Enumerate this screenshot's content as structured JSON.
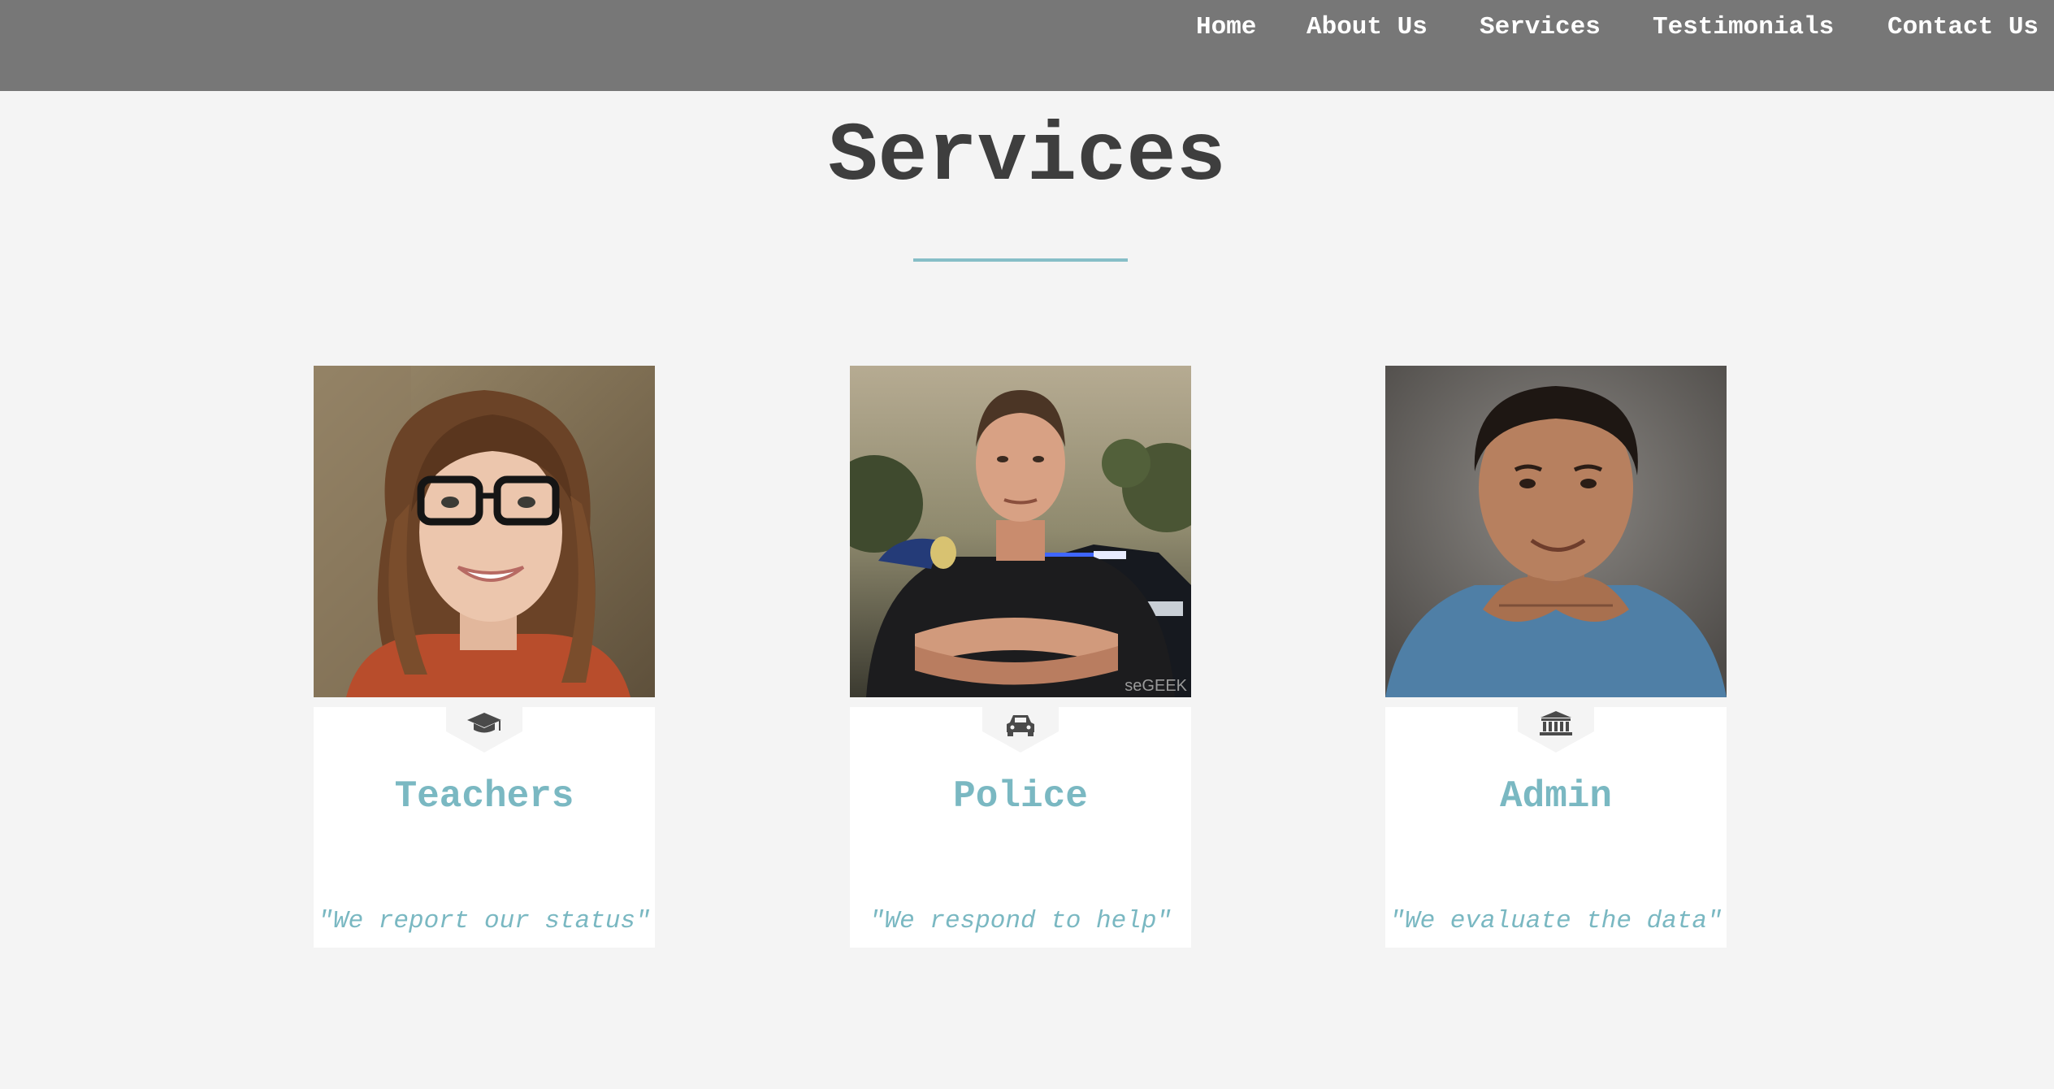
{
  "nav": {
    "items": [
      {
        "label": "Home"
      },
      {
        "label": "About Us"
      },
      {
        "label": "Services"
      },
      {
        "label": "Testimonials"
      },
      {
        "label": "Contact Us"
      }
    ]
  },
  "section": {
    "title": "Services"
  },
  "cards": [
    {
      "title": "Teachers",
      "quote": "\"We report our status\"",
      "icon": "graduation-cap-icon"
    },
    {
      "title": "Police",
      "quote": "\"We respond to help\"",
      "icon": "car-icon"
    },
    {
      "title": "Admin",
      "quote": "\"We evaluate the data\"",
      "icon": "bank-icon"
    }
  ],
  "colors": {
    "navbar": "#777777",
    "background": "#f4f4f4",
    "accent": "#7ab8c2",
    "title": "#3e3e3e"
  }
}
